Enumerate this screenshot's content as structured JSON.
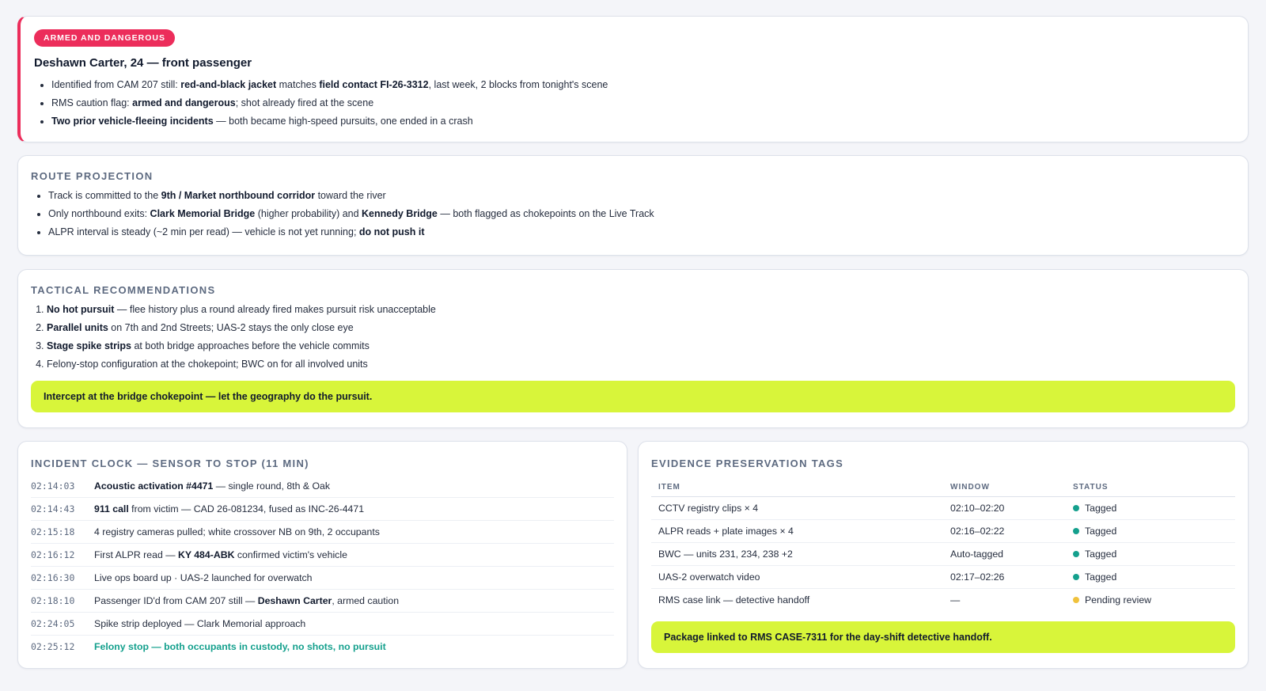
{
  "alert": {
    "badge": "ARMED AND DANGEROUS",
    "title": "Deshawn Carter, 24 — front passenger",
    "bullets": [
      [
        {
          "t": "Identified from CAM 207 still: "
        },
        {
          "t": "red-and-black jacket",
          "b": true
        },
        {
          "t": " matches "
        },
        {
          "t": "field contact FI-26-3312",
          "b": true
        },
        {
          "t": ", last week, 2 blocks from tonight's scene"
        }
      ],
      [
        {
          "t": "RMS caution flag: "
        },
        {
          "t": "armed and dangerous",
          "b": true
        },
        {
          "t": "; shot already fired at the scene"
        }
      ],
      [
        {
          "t": "Two prior vehicle-fleeing incidents",
          "b": true
        },
        {
          "t": " — both became high-speed pursuits, one ended in a crash"
        }
      ]
    ]
  },
  "route": {
    "title": "ROUTE PROJECTION",
    "bullets": [
      [
        {
          "t": "Track is committed to the "
        },
        {
          "t": "9th / Market northbound corridor",
          "b": true
        },
        {
          "t": " toward the river"
        }
      ],
      [
        {
          "t": "Only northbound exits: "
        },
        {
          "t": "Clark Memorial Bridge",
          "b": true
        },
        {
          "t": " (higher probability) and "
        },
        {
          "t": "Kennedy Bridge",
          "b": true
        },
        {
          "t": " — both flagged as chokepoints on the Live Track"
        }
      ],
      [
        {
          "t": "ALPR interval is steady (~2 min per read) — vehicle is not yet running; "
        },
        {
          "t": "do not push it",
          "b": true
        }
      ]
    ]
  },
  "tactical": {
    "title": "TACTICAL RECOMMENDATIONS",
    "items": [
      [
        {
          "t": "No hot pursuit",
          "b": true
        },
        {
          "t": " — flee history plus a round already fired makes pursuit risk unacceptable"
        }
      ],
      [
        {
          "t": "Parallel units",
          "b": true
        },
        {
          "t": " on 7th and 2nd Streets; UAS-2 stays the only close eye"
        }
      ],
      [
        {
          "t": "Stage spike strips",
          "b": true
        },
        {
          "t": " at both bridge approaches before the vehicle commits"
        }
      ],
      [
        {
          "t": "Felony-stop configuration at the chokepoint; BWC on for all involved units"
        }
      ]
    ],
    "callout": "Intercept at the bridge chokepoint — let the geography do the pursuit."
  },
  "clock": {
    "title": "INCIDENT CLOCK — SENSOR TO STOP (11 MIN)",
    "rows": [
      {
        "time": "02:14:03",
        "text": [
          {
            "t": "Acoustic activation #4471",
            "b": true
          },
          {
            "t": " — single round, 8th & Oak"
          }
        ]
      },
      {
        "time": "02:14:43",
        "text": [
          {
            "t": "911 call",
            "b": true
          },
          {
            "t": " from victim — CAD 26-081234, fused as INC-26-4471"
          }
        ]
      },
      {
        "time": "02:15:18",
        "text": [
          {
            "t": "4 registry cameras pulled; white crossover NB on 9th, 2 occupants"
          }
        ]
      },
      {
        "time": "02:16:12",
        "text": [
          {
            "t": "First ALPR read — "
          },
          {
            "t": "KY 484-ABK",
            "b": true
          },
          {
            "t": " confirmed victim's vehicle"
          }
        ]
      },
      {
        "time": "02:16:30",
        "text": [
          {
            "t": "Live ops board up · UAS-2 launched for overwatch"
          }
        ]
      },
      {
        "time": "02:18:10",
        "text": [
          {
            "t": "Passenger ID'd from CAM 207 still — "
          },
          {
            "t": "Deshawn Carter",
            "b": true
          },
          {
            "t": ", armed caution"
          }
        ]
      },
      {
        "time": "02:24:05",
        "text": [
          {
            "t": "Spike strip deployed — Clark Memorial approach"
          }
        ]
      },
      {
        "time": "02:25:12",
        "final": true,
        "text": [
          {
            "t": "Felony stop — both occupants in custody, no shots, no pursuit"
          }
        ]
      }
    ]
  },
  "evidence": {
    "title": "EVIDENCE PRESERVATION TAGS",
    "columns": [
      "ITEM",
      "WINDOW",
      "STATUS"
    ],
    "rows": [
      {
        "item": "CCTV registry clips × 4",
        "window": "02:10–02:20",
        "status": "Tagged",
        "color": "#14a08d"
      },
      {
        "item": "ALPR reads + plate images × 4",
        "window": "02:16–02:22",
        "status": "Tagged",
        "color": "#14a08d"
      },
      {
        "item": "BWC — units 231, 234, 238 +2",
        "window": "Auto-tagged",
        "status": "Tagged",
        "color": "#14a08d"
      },
      {
        "item": "UAS-2 overwatch video",
        "window": "02:17–02:26",
        "status": "Tagged",
        "color": "#14a08d"
      },
      {
        "item": "RMS case link — detective handoff",
        "window": "—",
        "status": "Pending review",
        "color": "#f0c23c"
      }
    ],
    "callout": "Package linked to RMS CASE-7311 for the day-shift detective handoff."
  }
}
